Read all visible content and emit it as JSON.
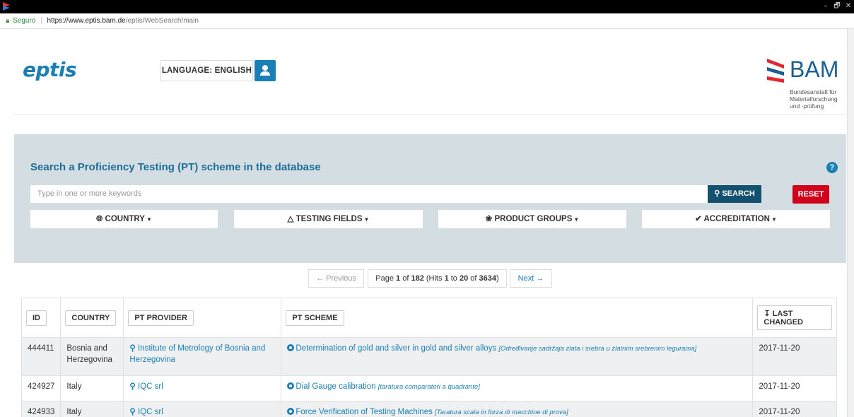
{
  "window": {
    "controls": [
      "–",
      "🗗",
      "✕"
    ]
  },
  "address_bar": {
    "secure_label": "Seguro",
    "host": "https://www.eptis.bam.de",
    "path": "/eptis/WebSearch/main"
  },
  "header": {
    "logo": "eptis",
    "language_button": "LANGUAGE: ENGLISH",
    "bam": {
      "name": "BAM",
      "subtitle": [
        "Bundesanstalt für",
        "Materialforschung",
        "und -prüfung"
      ]
    }
  },
  "search": {
    "title": "Search a Proficiency Testing (PT) scheme in the database",
    "placeholder": "Type in one or more keywords",
    "search_button": "SEARCH",
    "reset_button": "RESET",
    "filters": [
      "COUNTRY",
      "TESTING FIELDS",
      "PRODUCT GROUPS",
      "ACCREDITATION"
    ]
  },
  "pagination": {
    "prev": "← Previous",
    "next": "Next →",
    "info_parts": {
      "page_word": "Page ",
      "page": "1",
      "of_word": " of ",
      "pages": "182",
      "hits_word": " (Hits ",
      "from": "1",
      "to_word": " to ",
      "to": "20",
      "of2": " of ",
      "total": "3634",
      "close": ")"
    }
  },
  "table": {
    "headers": [
      "ID",
      "COUNTRY",
      "PT PROVIDER",
      "PT SCHEME",
      "LAST CHANGED"
    ],
    "rows": [
      {
        "id": "444411",
        "country": "Bosnia and Herzegovina",
        "provider": "Institute of Metrology of Bosnia and Herzegovina",
        "scheme": "Determination of gold and silver in gold and silver alloys",
        "scheme_alt": "[Određivanje sadržaja zlata i srebra u zlatnim srebrenim legurama]",
        "changed": "2017-11-20"
      },
      {
        "id": "424927",
        "country": "Italy",
        "provider": "IQC srl",
        "scheme": "Dial Gauge calibration",
        "scheme_alt": "[taratura comparatori a quadrante]",
        "changed": "2017-11-20"
      },
      {
        "id": "424933",
        "country": "Italy",
        "provider": "IQC srl",
        "scheme": "Force Verification of Testing Machines",
        "scheme_alt": "[Taratura scala in forza di macchine di prova]",
        "changed": "2017-11-20"
      }
    ]
  },
  "colors": {
    "accent": "#1a7fb5",
    "panel": "#d4dde1",
    "search_btn": "#13516f",
    "reset": "#d0021b"
  }
}
